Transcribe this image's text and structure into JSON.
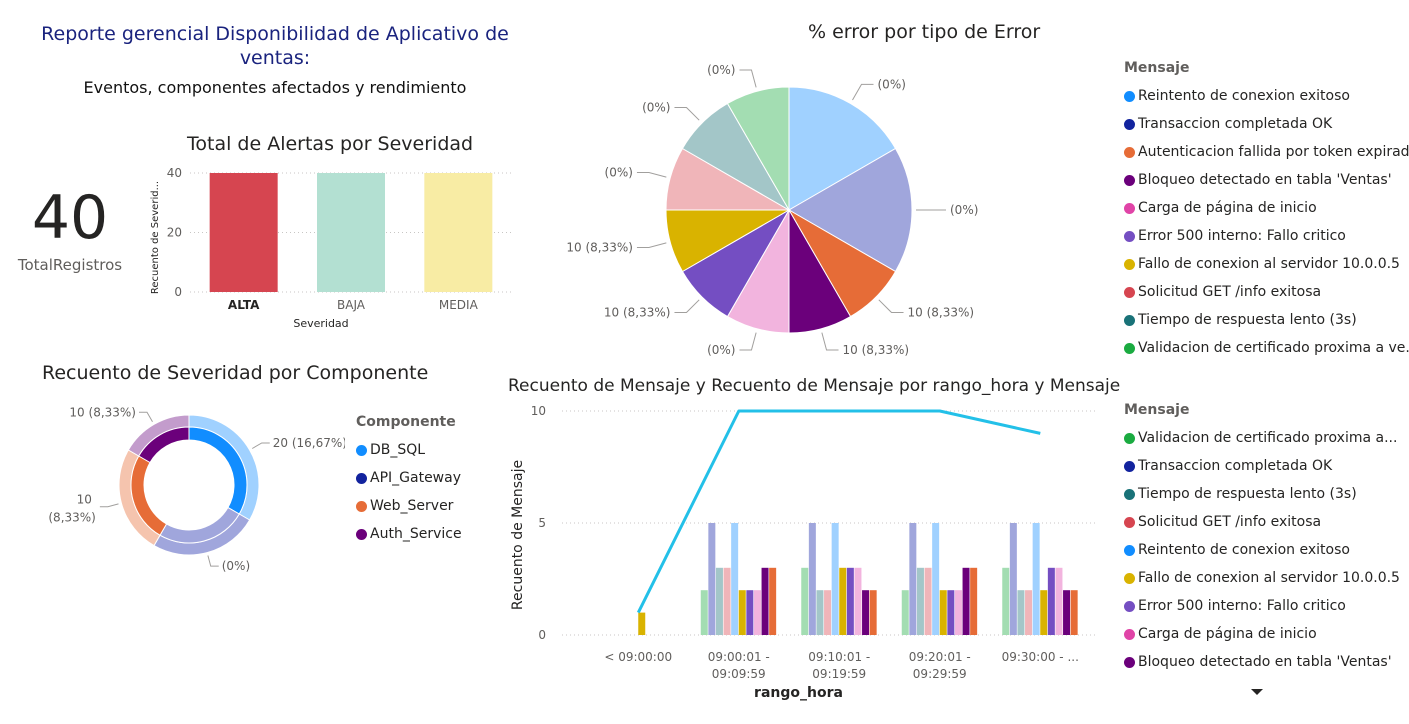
{
  "report": {
    "title": "Reporte gerencial Disponibilidad de Aplicativo de ventas:",
    "subtitle": "Eventos, componentes afectados y rendimiento"
  },
  "card": {
    "value": "40",
    "label": "TotalRegistros"
  },
  "colors": {
    "Reintento de conexion exitoso": "#118dff",
    "Transaccion completada OK": "#12239e",
    "Autenticacion fallida por token expirado": "#e66c37",
    "Bloqueo detectado en tabla 'Ventas'": "#6b007b",
    "Carga de página de inicio": "#e044a7",
    "Error 500 interno: Fallo critico": "#744ec2",
    "Fallo de conexion al servidor 10.0.0.5": "#d9b300",
    "Solicitud GET /info exitosa": "#d64550",
    "Tiempo de respuesta lento (3s)": "#197278",
    "Validacion de certificado proxima a ve...": "#1aab40",
    "line": "#23c0e8"
  },
  "chart_data": [
    {
      "id": "bar",
      "type": "bar",
      "title": "Total de Alertas por Severidad",
      "xlabel": "Severidad",
      "ylabel": "Recuento de Severid...",
      "categories": [
        "ALTA",
        "BAJA",
        "MEDIA"
      ],
      "values": [
        40,
        40,
        40
      ],
      "colors": [
        "#d64550",
        "#b3e0d2",
        "#f8eca4"
      ],
      "yticks": [
        "0",
        "20",
        "40"
      ],
      "ylim": [
        0,
        40
      ],
      "grid": true
    },
    {
      "id": "pie",
      "type": "pie",
      "title": "% error por tipo de Error",
      "legend_title": "Mensaje",
      "legend": [
        "Reintento de conexion exitoso",
        "Transaccion completada OK",
        "Autenticacion fallida por token expirado",
        "Bloqueo detectado en tabla 'Ventas'",
        "Carga de página de inicio",
        "Error 500 interno: Fallo critico",
        "Fallo de conexion al servidor 10.0.0.5",
        "Solicitud GET /info exitosa",
        "Tiempo de respuesta lento (3s)",
        "Validacion de certificado proxima a ve..."
      ],
      "slices": [
        {
          "value": 5,
          "color": "#a0d1ff",
          "label": "(0%)"
        },
        {
          "value": 5,
          "color": "#a0a6dc",
          "label": "(0%)"
        },
        {
          "value": 2.5,
          "color": "#e66c37",
          "label": "10 (8,33%)"
        },
        {
          "value": 2.5,
          "color": "#6b007b",
          "label": "10 (8,33%)"
        },
        {
          "value": 2.5,
          "color": "#f2b4de",
          "label": "(0%)"
        },
        {
          "value": 2.5,
          "color": "#744ec2",
          "label": "10 (8,33%)"
        },
        {
          "value": 2.5,
          "color": "#d9b300",
          "label": "10 (8,33%)"
        },
        {
          "value": 2.5,
          "color": "#f0b5b9",
          "label": "(0%)"
        },
        {
          "value": 2.5,
          "color": "#a3c6c8",
          "label": "(0%)"
        },
        {
          "value": 2.5,
          "color": "#a3ddb2",
          "label": "(0%)"
        }
      ]
    },
    {
      "id": "donut",
      "type": "pie",
      "title": "Recuento de Severidad por Componente",
      "legend_title": "Componente",
      "legend": [
        {
          "name": "DB_SQL",
          "color": "#118dff"
        },
        {
          "name": "API_Gateway",
          "color": "#12239e"
        },
        {
          "name": "Web_Server",
          "color": "#e66c37"
        },
        {
          "name": "Auth_Service",
          "color": "#6b007b"
        }
      ],
      "outer": [
        {
          "value": 20,
          "color": "#a0d1ff",
          "label": "20 (16,67%)"
        },
        {
          "value": 15,
          "color": "#a0a6dc",
          "label": "(0%)"
        },
        {
          "value": 15,
          "color": "#f5c4ae",
          "label": "10 (8,33%)"
        },
        {
          "value": 10,
          "color": "#c39ccc",
          "label": "10 (8,33%)"
        }
      ],
      "inner": [
        {
          "value": 20,
          "color": "#118dff"
        },
        {
          "value": 15,
          "color": "#a0a6dc"
        },
        {
          "value": 15,
          "color": "#e66c37"
        },
        {
          "value": 10,
          "color": "#6b007b"
        }
      ]
    },
    {
      "id": "combo",
      "type": "bar",
      "title": "Recuento de Mensaje y Recuento de Mensaje por rango_hora y Mensaje",
      "xlabel": "rango_hora",
      "ylabel": "Recuento de Mensaje",
      "yticks": [
        "0",
        "5",
        "10"
      ],
      "ylim": [
        0,
        10
      ],
      "categories": [
        [
          "< 09:00:00"
        ],
        [
          "09:00:01 -",
          "09:09:59"
        ],
        [
          "09:10:01 -",
          "09:19:59"
        ],
        [
          "09:20:01 -",
          "09:29:59"
        ],
        [
          "09:30:00 - ..."
        ]
      ],
      "series_order": [
        "Validacion de certificado proxima a...",
        "Transaccion completada OK",
        "Tiempo de respuesta lento (3s)",
        "Solicitud GET /info exitosa",
        "Reintento de conexion exitoso",
        "Fallo de conexion al servidor 10.0.0.5",
        "Error 500 interno: Fallo critico",
        "Carga de página de inicio",
        "Bloqueo detectado en tabla 'Ventas'"
      ],
      "bar_colors": [
        "#a3ddb2",
        "#a0a6dc",
        "#a3c6c8",
        "#f0b5b9",
        "#a0d1ff",
        "#d9b300",
        "#744ec2",
        "#f2b4de",
        "#6b007b",
        "#e66c37"
      ],
      "bar_values": [
        [
          0,
          0,
          0,
          0,
          0,
          1,
          0,
          0,
          0,
          0
        ],
        [
          2,
          5,
          3,
          3,
          5,
          2,
          2,
          2,
          3,
          3
        ],
        [
          3,
          5,
          2,
          2,
          5,
          3,
          3,
          3,
          2,
          2
        ],
        [
          2,
          5,
          3,
          3,
          5,
          2,
          2,
          2,
          3,
          3
        ],
        [
          3,
          5,
          2,
          2,
          5,
          2,
          3,
          3,
          2,
          2
        ]
      ],
      "line_values": [
        1,
        10,
        10,
        10,
        9
      ],
      "legend_title": "Mensaje",
      "legend": [
        {
          "name": "Validacion de certificado proxima a...",
          "color": "#1aab40"
        },
        {
          "name": "Transaccion completada OK",
          "color": "#12239e"
        },
        {
          "name": "Tiempo de respuesta lento (3s)",
          "color": "#197278"
        },
        {
          "name": "Solicitud GET /info exitosa",
          "color": "#d64550"
        },
        {
          "name": "Reintento de conexion exitoso",
          "color": "#118dff"
        },
        {
          "name": "Fallo de conexion al servidor 10.0.0.5",
          "color": "#d9b300"
        },
        {
          "name": "Error 500 interno: Fallo critico",
          "color": "#744ec2"
        },
        {
          "name": "Carga de página de inicio",
          "color": "#e044a7"
        },
        {
          "name": "Bloqueo detectado en tabla 'Ventas'",
          "color": "#6b007b"
        }
      ]
    }
  ]
}
